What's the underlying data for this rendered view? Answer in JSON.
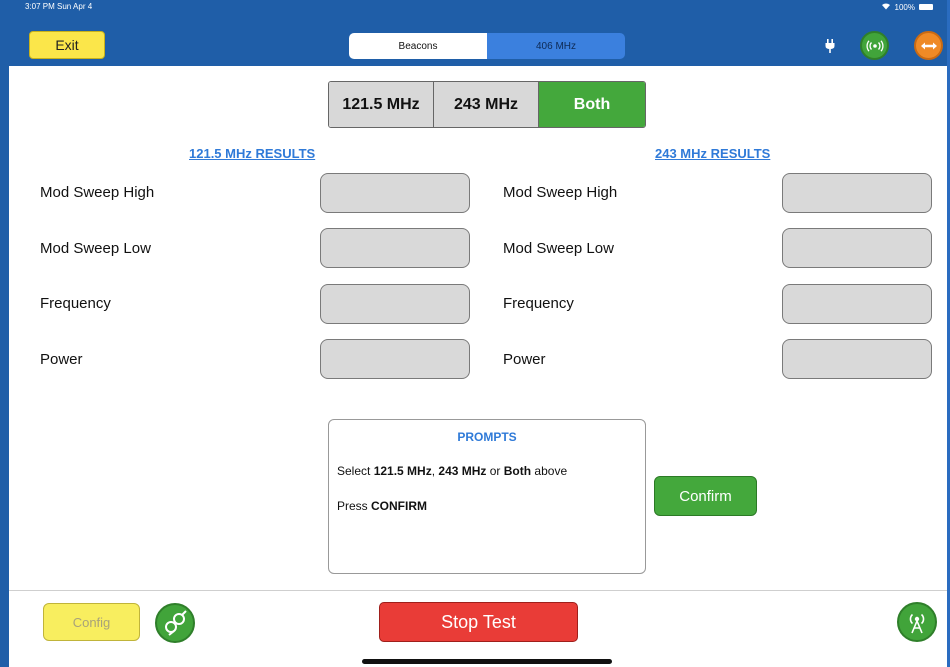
{
  "status": {
    "time": "3:07 PM  Sun Apr 4",
    "battery": "100%"
  },
  "header": {
    "exit_label": "Exit",
    "tabs": [
      {
        "label": "Beacons",
        "active": true
      },
      {
        "label": "406 MHz",
        "active": false
      }
    ],
    "icons": [
      "plug-icon",
      "signal-icon",
      "arrows-icon"
    ]
  },
  "frequency_selector": {
    "options": [
      "121.5 MHz",
      "243 MHz",
      "Both"
    ],
    "selected": "Both"
  },
  "results": {
    "left_heading": "121.5 MHz  RESULTS",
    "right_heading": "243 MHz  RESULTS",
    "rows": [
      "Mod Sweep High",
      "Mod Sweep Low",
      "Frequency",
      "Power"
    ]
  },
  "prompts": {
    "title": "PROMPTS",
    "line1_prefix": "Select ",
    "line1_a": "121.5 MHz",
    "line1_sep": ", ",
    "line1_b": "243 MHz",
    "line1_or": " or ",
    "line1_c": "Both",
    "line1_suffix": " above",
    "line2_prefix": "Press ",
    "line2_bold": "CONFIRM"
  },
  "confirm_label": "Confirm",
  "footer": {
    "config_label": "Config",
    "stop_label": "Stop Test"
  },
  "colors": {
    "nav_blue": "#1f5ea8",
    "accent_green": "#44a83c",
    "stop_red": "#e93c37",
    "exit_yellow": "#fbe64a",
    "link_blue": "#2f7ad8"
  }
}
